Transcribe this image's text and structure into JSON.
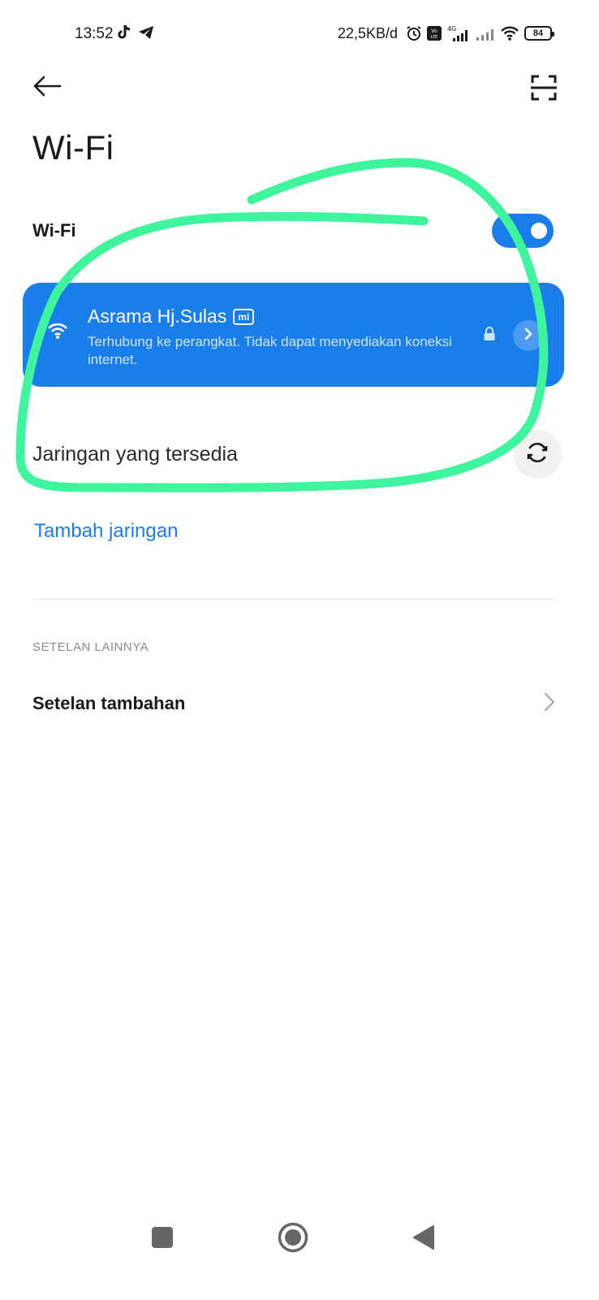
{
  "status_bar": {
    "time": "13:52",
    "network_speed": "22,5KB/d",
    "battery_level": "84",
    "icons": [
      "tiktok-icon",
      "telegram-icon",
      "alarm-icon",
      "volte-icon",
      "signal-4g-icon",
      "signal-icon",
      "wifi-icon",
      "battery-icon"
    ]
  },
  "header": {
    "back_icon": "arrow-left-icon",
    "scan_icon": "qr-scan-icon",
    "title": "Wi-Fi"
  },
  "wifi_toggle": {
    "label": "Wi-Fi",
    "enabled": true
  },
  "connected_network": {
    "name": "Asrama Hj.Sulas",
    "badge": "mi",
    "status": "Terhubung ke perangkat. Tidak dapat menyediakan koneksi internet.",
    "secured": true
  },
  "available_networks": {
    "label": "Jaringan yang tersedia",
    "refresh_icon": "refresh-icon"
  },
  "add_network": {
    "label": "Tambah jaringan"
  },
  "other_settings": {
    "header": "SETELAN LAINNYA",
    "items": [
      {
        "label": "Setelan tambahan"
      }
    ]
  },
  "navbar": {
    "icons": [
      "recents-icon",
      "home-icon",
      "back-icon"
    ]
  },
  "colors": {
    "accent": "#1a7eea",
    "annotation": "#3ef49c"
  }
}
